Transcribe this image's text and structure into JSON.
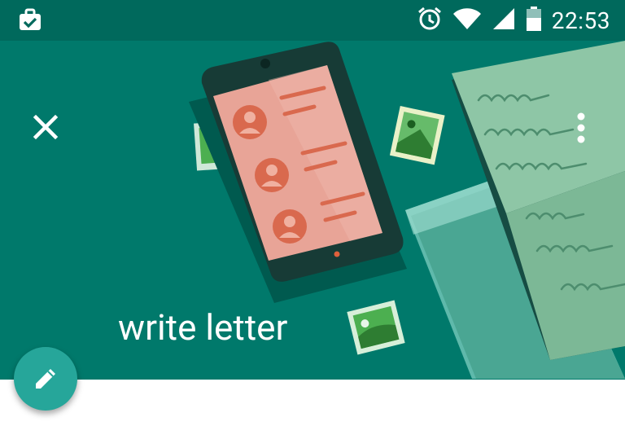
{
  "status_bar": {
    "time": "22:53",
    "icons": [
      "work-badge-icon",
      "alarm-icon",
      "wifi-icon",
      "signal-icon",
      "battery-icon"
    ]
  },
  "header": {
    "title": "write letter",
    "close_icon": "close-icon",
    "menu_icon": "more-vert-icon",
    "illustration": "phone-contacts-and-letter-illustration"
  },
  "fab": {
    "icon": "pencil-icon"
  },
  "colors": {
    "status_bar": "#00695c",
    "header": "#00796b",
    "fab": "#26a69a",
    "phone_screen": "#e8a497",
    "paper": "#8ec6a6"
  }
}
